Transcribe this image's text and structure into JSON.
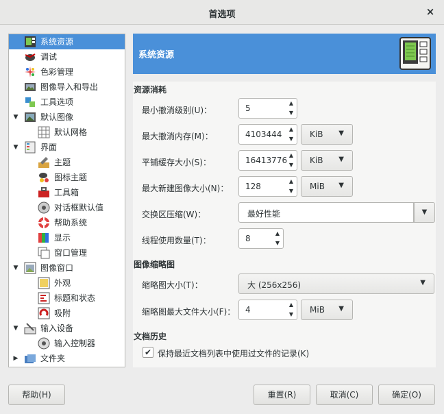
{
  "window": {
    "title": "首选项",
    "close_glyph": "×"
  },
  "tree": {
    "items": [
      {
        "label": "系统资源",
        "icon": "system-resources-icon",
        "selected": true
      },
      {
        "label": "调试",
        "icon": "debug-icon"
      },
      {
        "label": "色彩管理",
        "icon": "color-management-icon"
      },
      {
        "label": "图像导入和导出",
        "icon": "image-import-export-icon"
      },
      {
        "label": "工具选项",
        "icon": "tool-options-icon"
      },
      {
        "label": "默认图像",
        "icon": "default-image-icon",
        "expanded": true
      },
      {
        "label": "默认网格",
        "icon": "default-grid-icon"
      },
      {
        "label": "界面",
        "icon": "interface-icon",
        "expanded": true
      },
      {
        "label": "主题",
        "icon": "theme-icon"
      },
      {
        "label": "图标主题",
        "icon": "icon-theme-icon"
      },
      {
        "label": "工具箱",
        "icon": "toolbox-icon"
      },
      {
        "label": "对话框默认值",
        "icon": "dialog-defaults-icon"
      },
      {
        "label": "帮助系统",
        "icon": "help-system-icon"
      },
      {
        "label": "显示",
        "icon": "display-icon"
      },
      {
        "label": "窗口管理",
        "icon": "window-management-icon"
      },
      {
        "label": "图像窗口",
        "icon": "image-windows-icon",
        "expanded": true
      },
      {
        "label": "外观",
        "icon": "appearance-icon"
      },
      {
        "label": "标题和状态",
        "icon": "title-status-icon"
      },
      {
        "label": "吸附",
        "icon": "snapping-icon"
      },
      {
        "label": "输入设备",
        "icon": "input-devices-icon",
        "expanded": true
      },
      {
        "label": "输入控制器",
        "icon": "input-controllers-icon"
      },
      {
        "label": "文件夹",
        "icon": "folders-icon",
        "expanded": false
      }
    ]
  },
  "header": {
    "title": "系统资源",
    "icon": "system-resources-large-icon"
  },
  "resources": {
    "section_title": "资源消耗",
    "undo_levels": {
      "label": "最小撤消级别(U)：",
      "value": "5"
    },
    "undo_memory": {
      "label": "最大撤消内存(M)：",
      "value": "4103444",
      "unit": "KiB"
    },
    "tile_cache": {
      "label": "平铺缓存大小(S)：",
      "value": "16413776",
      "unit": "KiB"
    },
    "max_image": {
      "label": "最大新建图像大小(N)：",
      "value": "128",
      "unit": "MiB"
    },
    "swap_compression": {
      "label": "交换区压缩(W)：",
      "value": "最好性能"
    },
    "threads": {
      "label": "线程使用数量(T)：",
      "value": "8"
    }
  },
  "thumbnails": {
    "section_title": "图像缩略图",
    "size": {
      "label": "缩略图大小(T)：",
      "value": "大 (256x256)"
    },
    "max_file": {
      "label": "缩略图最大文件大小(F)：",
      "value": "4",
      "unit": "MiB"
    }
  },
  "history": {
    "section_title": "文档历史",
    "keep_recent": {
      "label": "保持最近文档列表中使用过文件的记录(K)",
      "checked": true,
      "check_glyph": "✔"
    }
  },
  "buttons": {
    "help": "帮助(H)",
    "reset": "重置(R)",
    "cancel": "取消(C)",
    "ok": "确定(O)"
  },
  "glyphs": {
    "up": "▲",
    "down": "▼",
    "caret": "▼",
    "expanded": "▼",
    "collapsed": "▶"
  },
  "colors": {
    "accent": "#4a90d9"
  }
}
